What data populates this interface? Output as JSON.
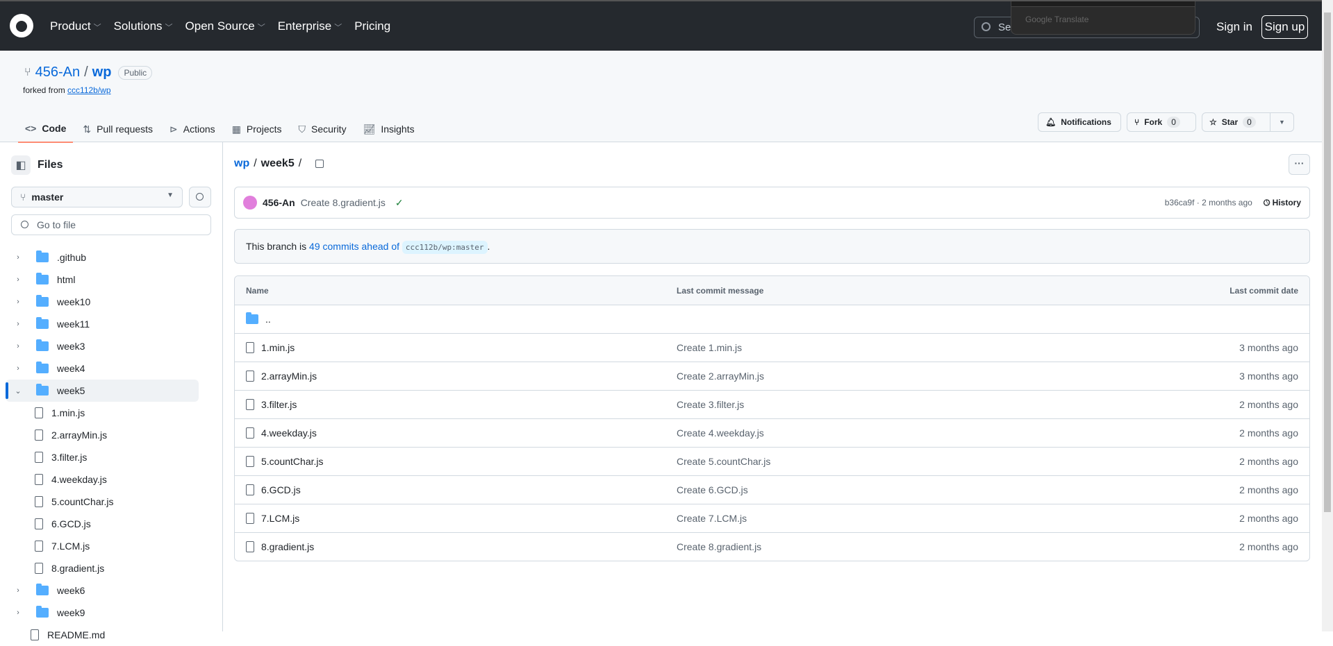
{
  "header": {
    "nav": [
      "Product",
      "Solutions",
      "Open Source",
      "Enterprise",
      "Pricing"
    ],
    "search_placeholder": "Sea",
    "translate_popup": "Google Translate",
    "sign_in": "Sign in",
    "sign_up": "Sign up"
  },
  "repo": {
    "owner": "456-An",
    "name": "wp",
    "visibility": "Public",
    "forked_from_label": "forked from",
    "forked_from": "ccc112b/wp",
    "notifications": "Notifications",
    "fork": "Fork",
    "fork_count": "0",
    "star": "Star",
    "star_count": "0",
    "tabs": [
      {
        "label": "Code",
        "icon": "code-icon"
      },
      {
        "label": "Pull requests",
        "icon": "pull-request-icon"
      },
      {
        "label": "Actions",
        "icon": "play-icon"
      },
      {
        "label": "Projects",
        "icon": "table-icon"
      },
      {
        "label": "Security",
        "icon": "shield-icon"
      },
      {
        "label": "Insights",
        "icon": "graph-icon"
      }
    ]
  },
  "sidebar": {
    "title": "Files",
    "branch": "master",
    "go_to_file": "Go to file",
    "tree": [
      {
        "name": ".github",
        "type": "dir"
      },
      {
        "name": "html",
        "type": "dir"
      },
      {
        "name": "week10",
        "type": "dir"
      },
      {
        "name": "week11",
        "type": "dir"
      },
      {
        "name": "week3",
        "type": "dir"
      },
      {
        "name": "week4",
        "type": "dir"
      },
      {
        "name": "week5",
        "type": "dir",
        "open": true
      },
      {
        "name": "1.min.js",
        "type": "file"
      },
      {
        "name": "2.arrayMin.js",
        "type": "file"
      },
      {
        "name": "3.filter.js",
        "type": "file"
      },
      {
        "name": "4.weekday.js",
        "type": "file"
      },
      {
        "name": "5.countChar.js",
        "type": "file"
      },
      {
        "name": "6.GCD.js",
        "type": "file"
      },
      {
        "name": "7.LCM.js",
        "type": "file"
      },
      {
        "name": "8.gradient.js",
        "type": "file"
      },
      {
        "name": "week6",
        "type": "dir"
      },
      {
        "name": "week9",
        "type": "dir"
      },
      {
        "name": "README.md",
        "type": "file"
      }
    ]
  },
  "main": {
    "breadcrumb": {
      "root": "wp",
      "sep": "/",
      "folder": "week5",
      "trail": "/"
    },
    "commit": {
      "author": "456-An",
      "message": "Create 8.gradient.js",
      "sha": "b36ca9f",
      "time": "· 2 months ago",
      "history": "History"
    },
    "ahead": {
      "prefix": "This branch is",
      "link": "49 commits ahead of",
      "ref": "ccc112b/wp:master",
      "suffix": "."
    },
    "table": {
      "headers": [
        "Name",
        "Last commit message",
        "Last commit date"
      ],
      "parent": "..",
      "rows": [
        [
          "1.min.js",
          "Create 1.min.js",
          "3 months ago"
        ],
        [
          "2.arrayMin.js",
          "Create 2.arrayMin.js",
          "3 months ago"
        ],
        [
          "3.filter.js",
          "Create 3.filter.js",
          "2 months ago"
        ],
        [
          "4.weekday.js",
          "Create 4.weekday.js",
          "2 months ago"
        ],
        [
          "5.countChar.js",
          "Create 5.countChar.js",
          "2 months ago"
        ],
        [
          "6.GCD.js",
          "Create 6.GCD.js",
          "2 months ago"
        ],
        [
          "7.LCM.js",
          "Create 7.LCM.js",
          "2 months ago"
        ],
        [
          "8.gradient.js",
          "Create 8.gradient.js",
          "2 months ago"
        ]
      ]
    }
  }
}
